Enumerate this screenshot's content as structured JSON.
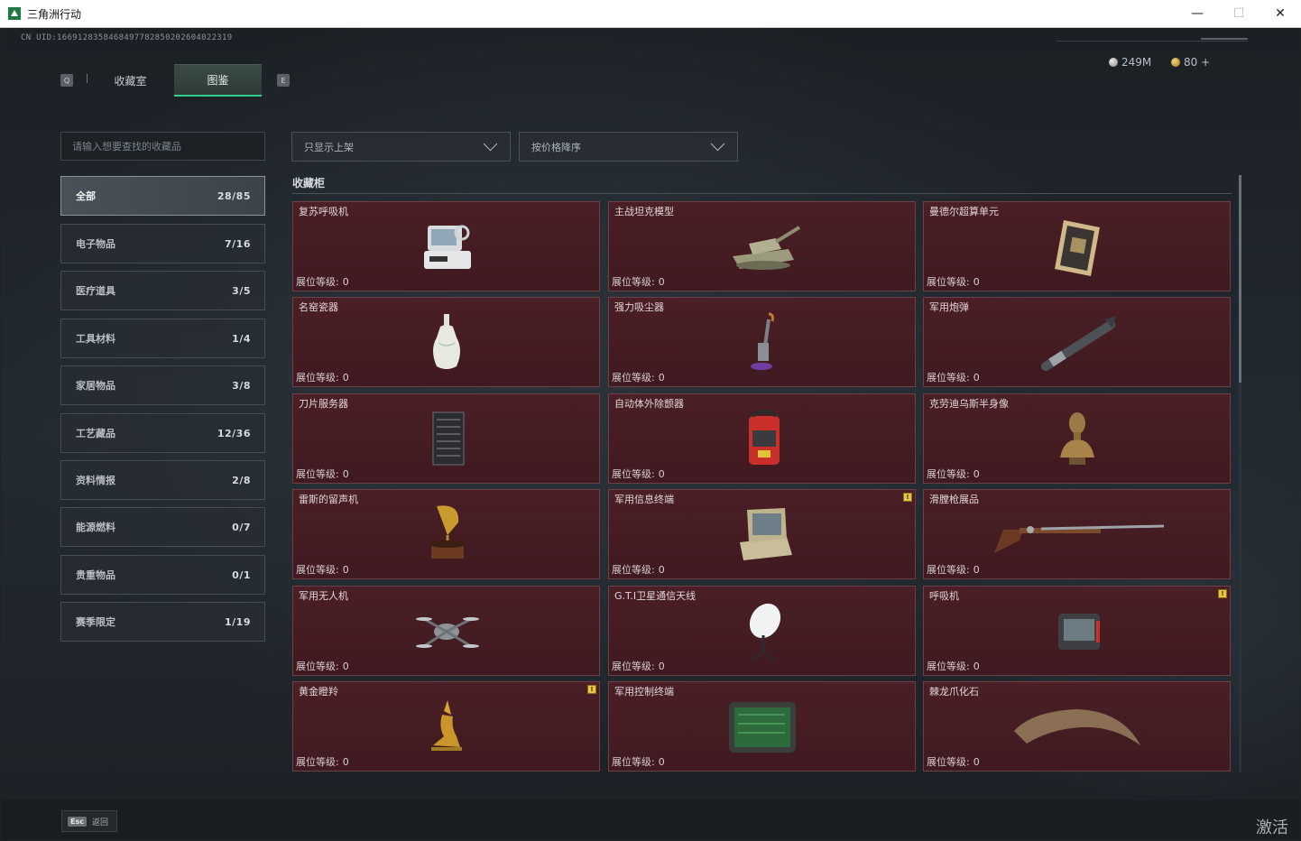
{
  "window": {
    "title": "三角洲行动",
    "controls": {
      "minimize": "—",
      "maximize": "☐",
      "close": "✕"
    }
  },
  "header": {
    "uid": "CN UID:1669128358468497782850202604022319",
    "currency": [
      {
        "icon": "silver-coin-icon",
        "value": "249M"
      },
      {
        "icon": "gold-coin-icon",
        "value": "80 +"
      }
    ]
  },
  "tabs": {
    "prev_key": "Q",
    "next_key": "E",
    "items": [
      {
        "label": "收藏室",
        "active": false
      },
      {
        "label": "图鉴",
        "active": true
      }
    ]
  },
  "search": {
    "placeholder": "请输入想要查找的收藏品"
  },
  "categories": [
    {
      "label": "全部",
      "count": "28/85",
      "active": true
    },
    {
      "label": "电子物品",
      "count": "7/16"
    },
    {
      "label": "医疗道具",
      "count": "3/5"
    },
    {
      "label": "工具材料",
      "count": "1/4"
    },
    {
      "label": "家居物品",
      "count": "3/8"
    },
    {
      "label": "工艺藏品",
      "count": "12/36"
    },
    {
      "label": "资料情报",
      "count": "2/8"
    },
    {
      "label": "能源燃料",
      "count": "0/7"
    },
    {
      "label": "贵重物品",
      "count": "0/1"
    },
    {
      "label": "赛季限定",
      "count": "1/19"
    }
  ],
  "filters": {
    "show": "只显示上架",
    "sort": "按价格降序"
  },
  "section": {
    "title": "收藏柜"
  },
  "level_label": "展位等级:",
  "items": [
    {
      "name": "复苏呼吸机",
      "level": "0",
      "icon": "resuscitator-icon"
    },
    {
      "name": "主战坦克模型",
      "level": "0",
      "icon": "tank-model-icon"
    },
    {
      "name": "曼德尔超算单元",
      "level": "0",
      "icon": "supercomputer-unit-icon"
    },
    {
      "name": "名窑瓷器",
      "level": "0",
      "icon": "porcelain-vase-icon"
    },
    {
      "name": "强力吸尘器",
      "level": "0",
      "icon": "vacuum-cleaner-icon"
    },
    {
      "name": "军用炮弹",
      "level": "0",
      "icon": "artillery-shell-icon"
    },
    {
      "name": "刀片服务器",
      "level": "0",
      "icon": "blade-server-icon"
    },
    {
      "name": "自动体外除颤器",
      "level": "0",
      "icon": "defibrillator-icon"
    },
    {
      "name": "克劳迪乌斯半身像",
      "level": "0",
      "icon": "bust-statue-icon"
    },
    {
      "name": "雷斯的留声机",
      "level": "0",
      "icon": "gramophone-icon"
    },
    {
      "name": "军用信息终端",
      "level": "0",
      "icon": "military-terminal-icon",
      "badge": "!"
    },
    {
      "name": "滑膛枪展品",
      "level": "0",
      "icon": "musket-icon"
    },
    {
      "name": "军用无人机",
      "level": "0",
      "icon": "drone-icon"
    },
    {
      "name": "G.T.I卫星通信天线",
      "level": "0",
      "icon": "satellite-dish-icon"
    },
    {
      "name": "呼吸机",
      "level": "0",
      "icon": "ventilator-icon",
      "badge": "!"
    },
    {
      "name": "黄金瞪羚",
      "level": "0",
      "icon": "golden-gazelle-icon",
      "badge": "!"
    },
    {
      "name": "军用控制终端",
      "level": "0",
      "icon": "control-terminal-icon"
    },
    {
      "name": "棘龙爪化石",
      "level": "0",
      "icon": "claw-fossil-icon"
    }
  ],
  "footer": {
    "esc_key": "Esc",
    "esc_label": "返回"
  },
  "watermark": "激活"
}
